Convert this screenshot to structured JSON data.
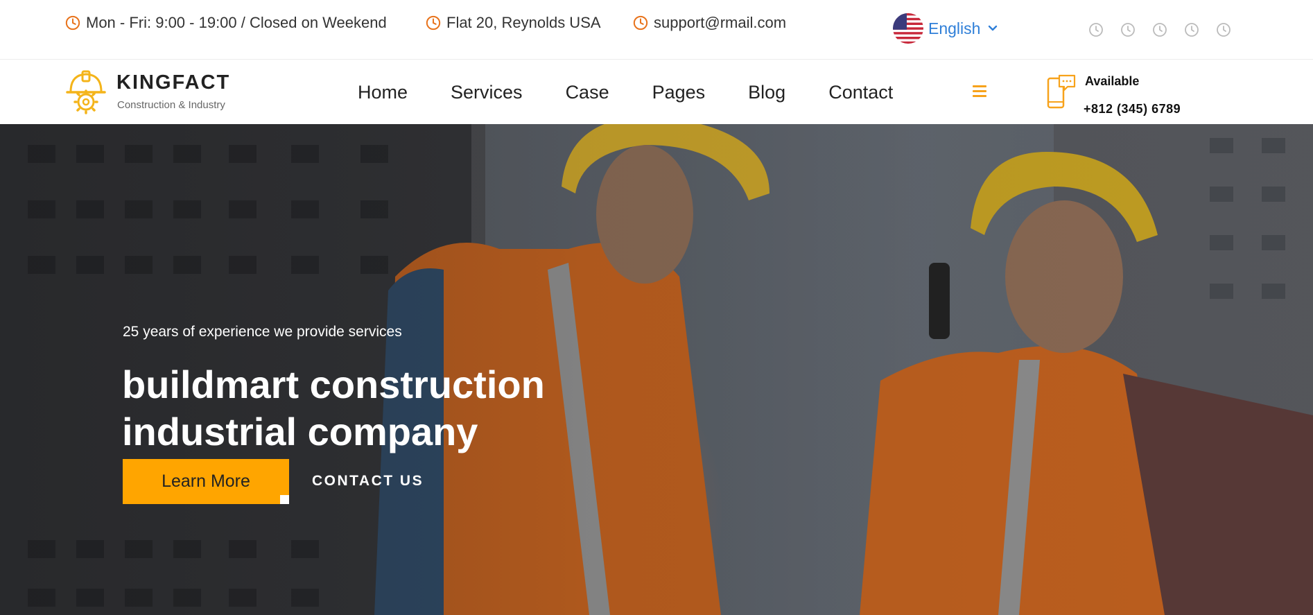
{
  "topbar": {
    "hours": "Mon - Fri: 9:00 - 19:00 / Closed on Weekend",
    "address": "Flat 20, Reynolds USA",
    "email": "support@rmail.com",
    "language": "English",
    "icon_color": "#e8731c"
  },
  "nav": {
    "logo_name": "KINGFACT",
    "logo_tagline": "Construction & Industry",
    "menu": [
      "Home",
      "Services",
      "Case",
      "Pages",
      "Blog",
      "Contact"
    ],
    "available_label": "Available",
    "phone": "+812 (345) 6789",
    "accent": "#f7a21b"
  },
  "hero": {
    "subtitle": "25 years of experience we provide services",
    "title_line1": "buildmart construction",
    "title_line2": "industrial company",
    "primary_button": "Learn More",
    "secondary_button": "CONTACT US",
    "button_color": "#ffa500"
  }
}
